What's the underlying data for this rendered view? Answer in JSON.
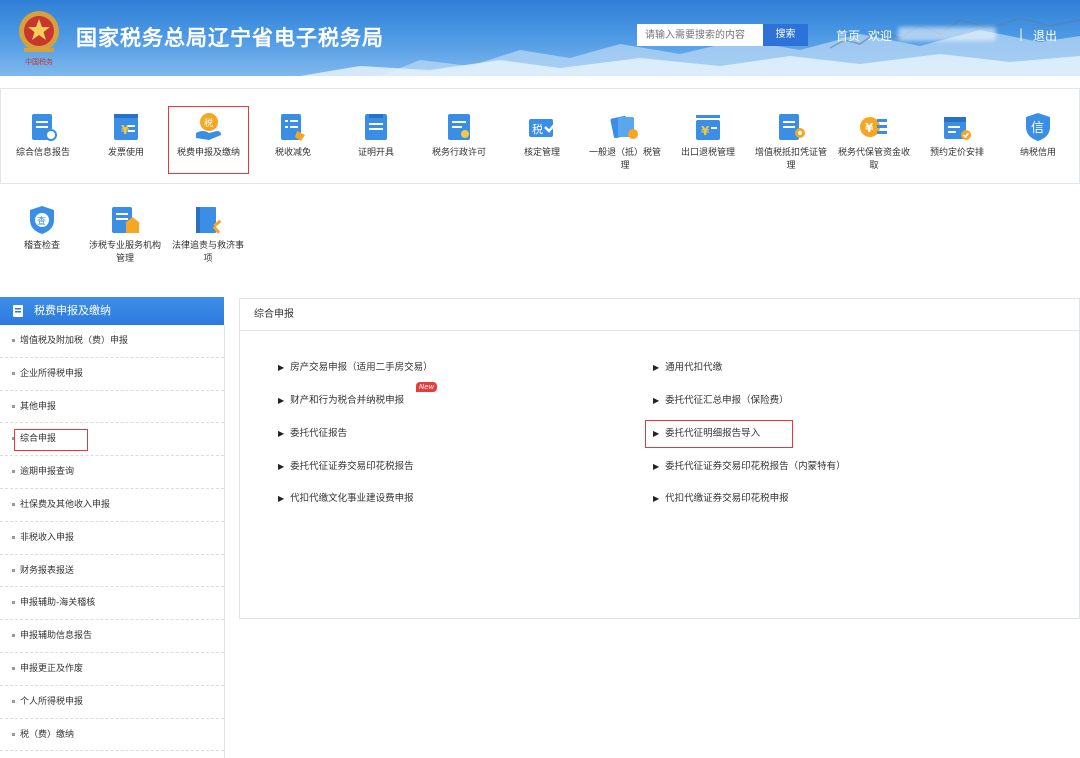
{
  "header": {
    "title": "国家税务总局辽宁省电子税务局",
    "emblem_caption": "中国税务",
    "search_placeholder": "请输入需要搜索的内容",
    "search_button": "搜索",
    "home_link": "首页",
    "welcome_text": "欢迎",
    "separator": "|",
    "logout_link": "退出"
  },
  "services_row1": [
    {
      "label": "综合信息报告",
      "icon": "report-icon"
    },
    {
      "label": "发票使用",
      "icon": "invoice-icon"
    },
    {
      "label": "税费申报及缴纳",
      "icon": "tax-filing-icon"
    },
    {
      "label": "税收减免",
      "icon": "tax-relief-icon"
    },
    {
      "label": "证明开具",
      "icon": "certificate-icon"
    },
    {
      "label": "税务行政许可",
      "icon": "license-icon"
    },
    {
      "label": "核定管理",
      "icon": "assessment-icon"
    },
    {
      "label": "一般退（抵）税管理",
      "icon": "refund-icon"
    },
    {
      "label": "出口退税管理",
      "icon": "export-refund-icon"
    },
    {
      "label": "增值税抵扣凭证管理",
      "icon": "vat-voucher-icon"
    },
    {
      "label": "税务代保管资金收取",
      "icon": "fund-custody-icon"
    },
    {
      "label": "预约定价安排",
      "icon": "pricing-agreement-icon"
    },
    {
      "label": "纳税信用",
      "icon": "credit-icon"
    }
  ],
  "services_row2": [
    {
      "label": "稽查检查",
      "icon": "inspection-icon"
    },
    {
      "label": "涉税专业服务机构管理",
      "icon": "agency-icon"
    },
    {
      "label": "法律追责与救济事项",
      "icon": "legal-icon"
    }
  ],
  "sidebar": {
    "title": "税费申报及缴纳",
    "items": [
      "增值税及附加税（费）申报",
      "企业所得税申报",
      "其他申报",
      "综合申报",
      "逾期申报查询",
      "社保费及其他收入申报",
      "非税收入申报",
      "财务报表报送",
      "申报辅助-海关稽核",
      "申报辅助信息报告",
      "申报更正及作废",
      "个人所得税申报",
      "税（费）缴纳"
    ]
  },
  "main": {
    "title": "综合申报",
    "new_badge": "New",
    "left_links": [
      "房产交易申报（适用二手房交易）",
      "财产和行为税合并纳税申报",
      "委托代征报告",
      "委托代征证券交易印花税报告",
      "代扣代缴文化事业建设费申报"
    ],
    "right_links": [
      "通用代扣代缴",
      "委托代征汇总申报（保险费）",
      "委托代征明细报告导入",
      "委托代征证券交易印花税报告（内蒙特有）",
      "代扣代缴证券交易印花税申报"
    ]
  },
  "colors": {
    "accent_blue": "#2c7adf",
    "highlight_red": "#e23a3a",
    "icon_blue": "#3a8ee6",
    "icon_orange": "#f5a623"
  }
}
